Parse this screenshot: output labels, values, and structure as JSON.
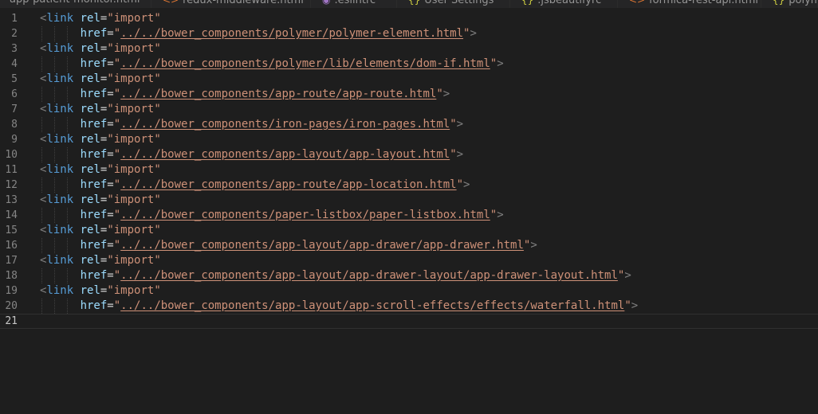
{
  "tabs": [
    {
      "label": "app-patient-monitor.html",
      "icon": "",
      "icon_color": "#e37933"
    },
    {
      "label": "redux-middleware.html",
      "icon": "<>",
      "icon_color": "#e37933"
    },
    {
      "label": ".eslintrc",
      "icon": "◉",
      "icon_color": "#a074c4"
    },
    {
      "label": "User Settings",
      "icon": "{}",
      "icon_color": "#cbcb41"
    },
    {
      "label": ".jsbeautifyrc",
      "icon": "{}",
      "icon_color": "#cbcb41"
    },
    {
      "label": "formica-rest-api.html",
      "icon": "<>",
      "icon_color": "#e37933"
    },
    {
      "label": "polym",
      "icon": "{}",
      "icon_color": "#cbcb41"
    }
  ],
  "editor": {
    "line_numbers": [
      "1",
      "2",
      "3",
      "4",
      "5",
      "6",
      "7",
      "8",
      "9",
      "10",
      "11",
      "12",
      "13",
      "14",
      "15",
      "16",
      "17",
      "18",
      "19",
      "20",
      "21"
    ],
    "link_tag": "<link",
    "rel_attr": "rel",
    "rel_value": "\"import\"",
    "href_attr": "href",
    "quote": "\"",
    "close": ">",
    "equals": "=",
    "hrefs": [
      "../../bower_components/polymer/polymer-element.html",
      "../../bower_components/polymer/lib/elements/dom-if.html",
      "../../bower_components/app-route/app-route.html",
      "../../bower_components/iron-pages/iron-pages.html",
      "../../bower_components/app-layout/app-layout.html",
      "../../bower_components/app-route/app-location.html",
      "../../bower_components/paper-listbox/paper-listbox.html",
      "../../bower_components/app-layout/app-drawer/app-drawer.html",
      "../../bower_components/app-layout/app-drawer-layout/app-drawer-layout.html",
      "../../bower_components/app-layout/app-scroll-effects/effects/waterfall.html"
    ],
    "active_line": "21"
  }
}
